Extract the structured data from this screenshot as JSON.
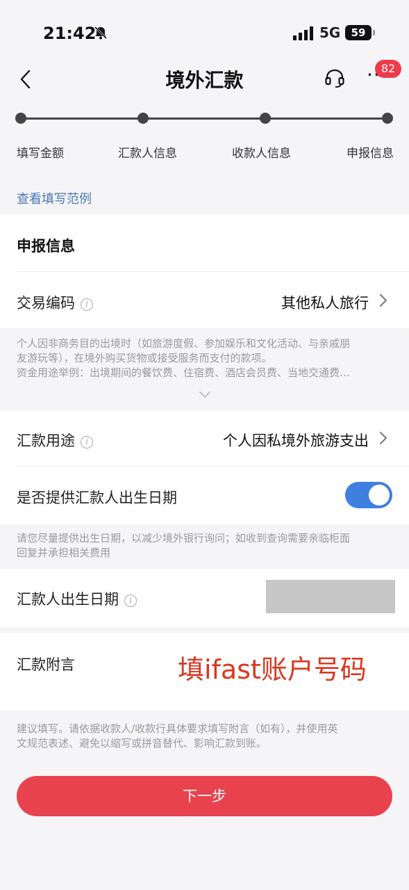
{
  "status_bar": {
    "time": "21:42",
    "network": "5G",
    "battery": "59"
  },
  "header": {
    "title": "境外汇款",
    "badge_count": "82",
    "more_label": "···"
  },
  "stepper": {
    "steps": [
      "填写金额",
      "汇款人信息",
      "收款人信息",
      "申报信息"
    ]
  },
  "example_link": "查看填写范例",
  "declaration": {
    "section_title": "申报信息",
    "transaction_code": {
      "label": "交易编码",
      "value": "其他私人旅行"
    },
    "transaction_note_line1": "个人因非商务目的出境时（如旅游度假、参加娱乐和文化活动、与亲戚朋",
    "transaction_note_line2": "友游玩等），在境外购买货物或接受服务而支付的款项。",
    "transaction_note_line3": "资金用途举例：出境期间的餐饮费、住宿费、酒店会员费、当地交通费…",
    "purpose": {
      "label": "汇款用途",
      "value": "个人因私境外旅游支出"
    },
    "birthdate_toggle": {
      "label": "是否提供汇款人出生日期",
      "enabled": true
    },
    "birthdate_note_line1": "请您尽量提供出生日期，以减少境外银行询问；如收到查询需要亲临柜面",
    "birthdate_note_line2": "回复并承担相关费用",
    "birthdate": {
      "label": "汇款人出生日期"
    },
    "memo": {
      "label": "汇款附言",
      "annotation": "填ifast账户号码"
    },
    "memo_note_line1": "建议填写。请依据收款人/收款行具体要求填写附言（如有），并使用英",
    "memo_note_line2": "文规范表述、避免以缩写或拼音替代、影响汇款到账。"
  },
  "next_button": "下一步",
  "colors": {
    "primary_red": "#e8424f",
    "toggle_blue": "#3e7fe0",
    "link_blue": "#4b78b5",
    "annotation_red": "#d8371f"
  }
}
